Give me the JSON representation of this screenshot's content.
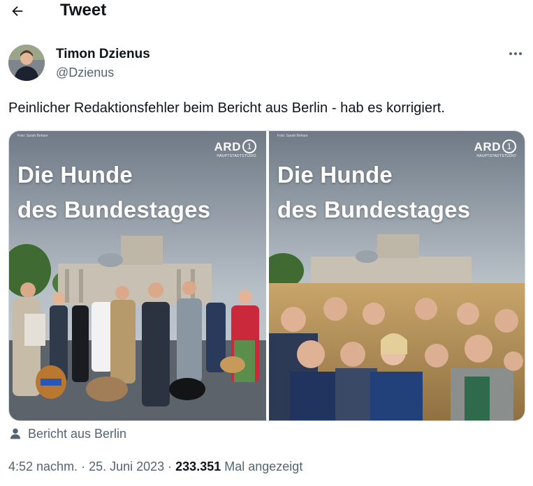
{
  "header": {
    "title": "Tweet",
    "back_icon": "arrow-left-icon"
  },
  "author": {
    "name": "Timon Dzienus",
    "handle": "@Dzienus",
    "more_icon": "more-horizontal-icon"
  },
  "tweet": {
    "text": "Peinlicher Redaktionsfehler beim Bericht aus Berlin - hab es korrigiert."
  },
  "media": [
    {
      "title_line1": "Die Hunde",
      "title_line2": "des Bundestages",
      "logo": "ARD",
      "logo_number": "1",
      "logo_sub": "HAUPTSTADTSTUDIO",
      "credit": "Foto: Sarah Behare"
    },
    {
      "title_line1": "Die Hunde",
      "title_line2": "des Bundestages",
      "logo": "ARD",
      "logo_number": "1",
      "logo_sub": "HAUPTSTADTSTUDIO",
      "credit": "Foto: Sarah Behare"
    }
  ],
  "source": {
    "label": "Bericht aus Berlin",
    "icon": "person-icon"
  },
  "meta": {
    "time": "4:52 nachm.",
    "separator": " · ",
    "date": "25. Juni 2023",
    "views": "233.351",
    "views_label": "Mal angezeigt"
  },
  "colors": {
    "text": "#0f1419",
    "secondary": "#536471",
    "border": "#cfd9de",
    "sky": "#a9b3bd"
  }
}
